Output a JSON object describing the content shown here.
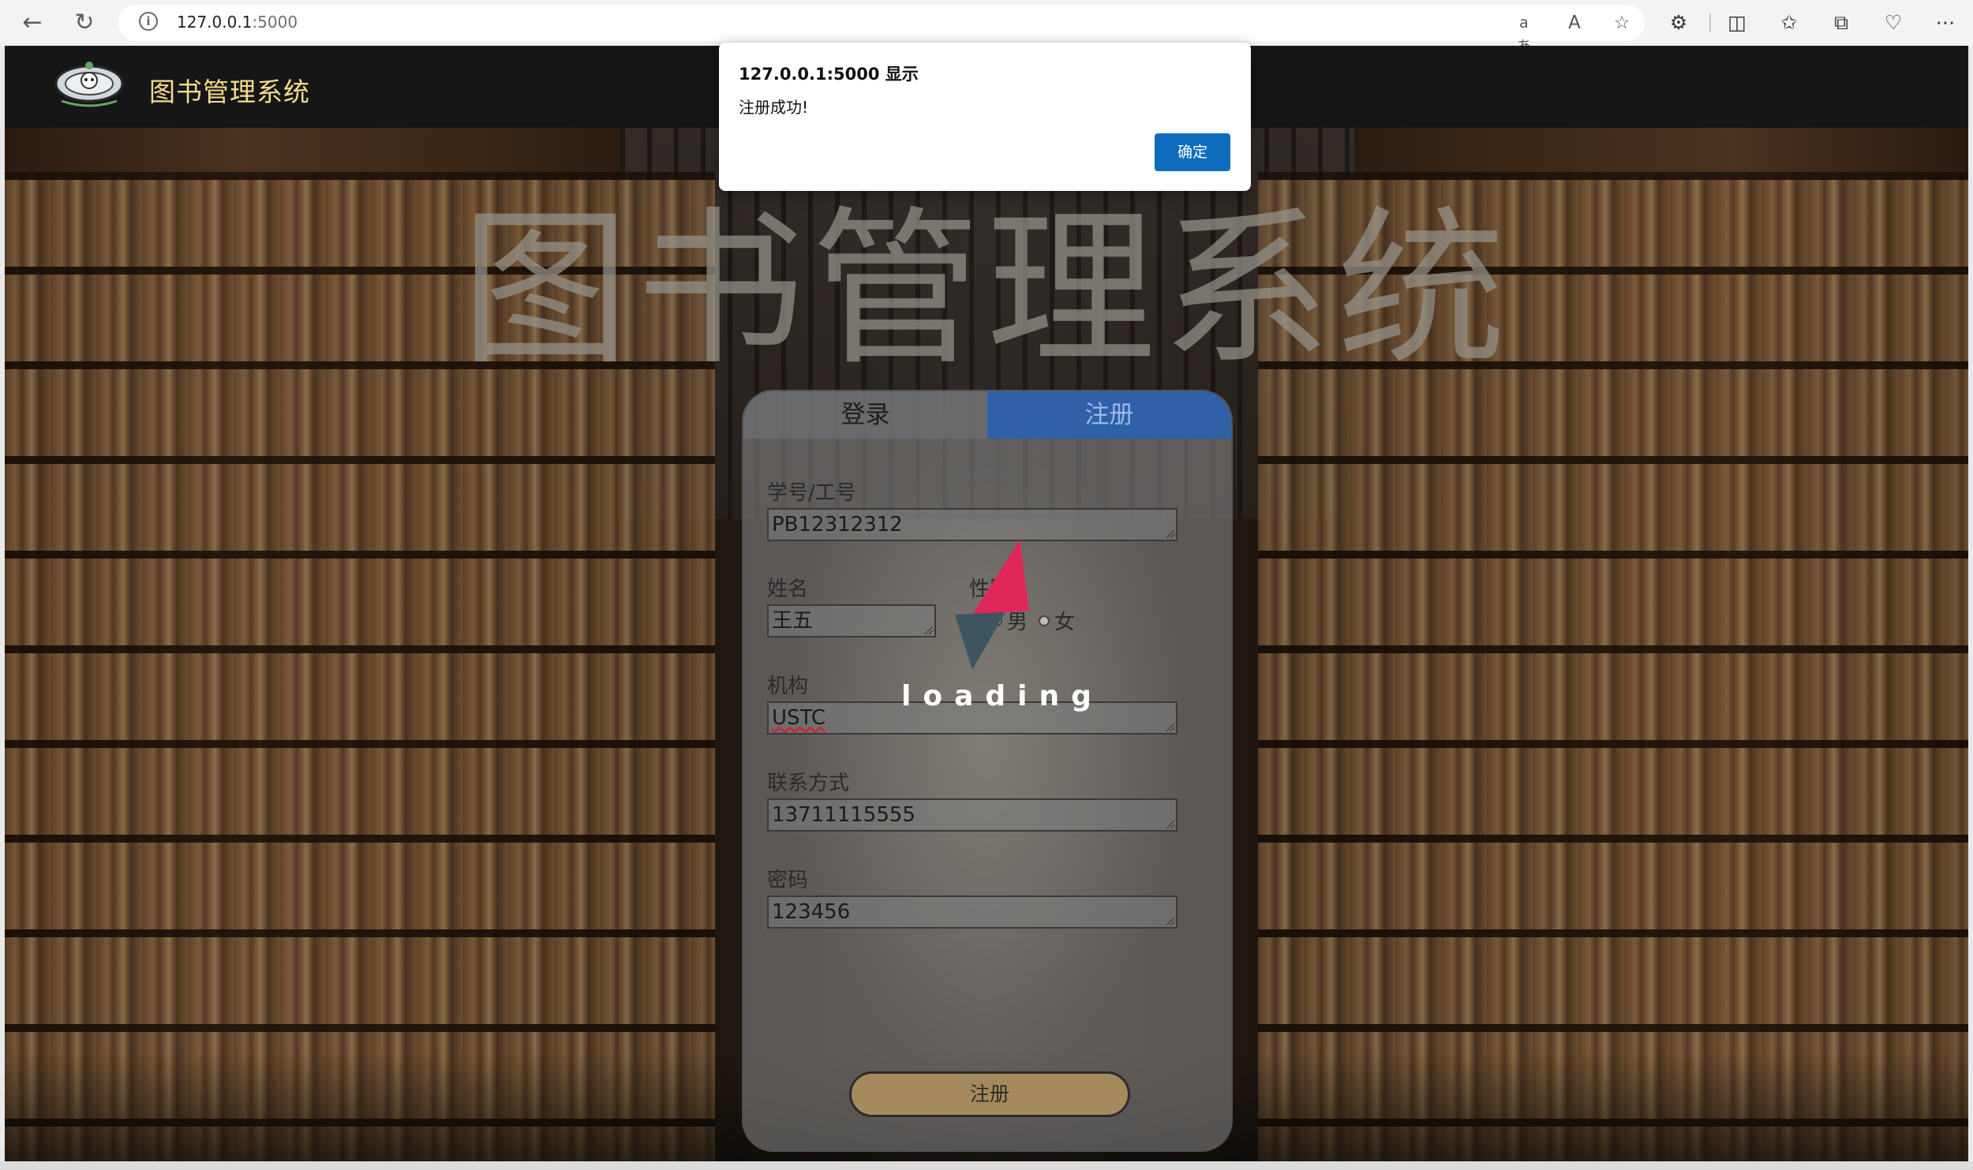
{
  "browser": {
    "url_host": "127.0.0.1",
    "url_port": ":5000",
    "icons": [
      "back-icon",
      "refresh-icon",
      "info-icon",
      "read-aloud-icon",
      "translate-icon",
      "favorite-star-icon",
      "extensions-icon",
      "split-screen-icon",
      "favorites-icon",
      "collections-icon",
      "performance-icon",
      "more-icon"
    ]
  },
  "site": {
    "name": "图书管理系统",
    "hero_title": "图书管理系统"
  },
  "tabs": {
    "login": "登录",
    "register": "注册"
  },
  "form": {
    "id_label": "学号/工号",
    "id_value": "PB12312312",
    "name_label": "姓名",
    "name_value": "王五",
    "gender_label": "性别",
    "gender_male": "男",
    "gender_female": "女",
    "org_label": "机构",
    "org_value": "USTC",
    "phone_label": "联系方式",
    "phone_value": "13711115555",
    "password_label": "密码",
    "password_value": "123456",
    "submit": "注册"
  },
  "loading": "loading",
  "dialog": {
    "title": "127.0.0.1:5000 显示",
    "message": "注册成功!",
    "ok": "确定"
  },
  "colors": {
    "header_bg": "#161616",
    "site_name": "#f7dc8c",
    "register_tab": "#2f60a8",
    "submit_button": "#a48a5c",
    "dialog_button": "#0f6cbd",
    "loader_red": "#e0275a",
    "loader_dark": "#3d5560"
  }
}
